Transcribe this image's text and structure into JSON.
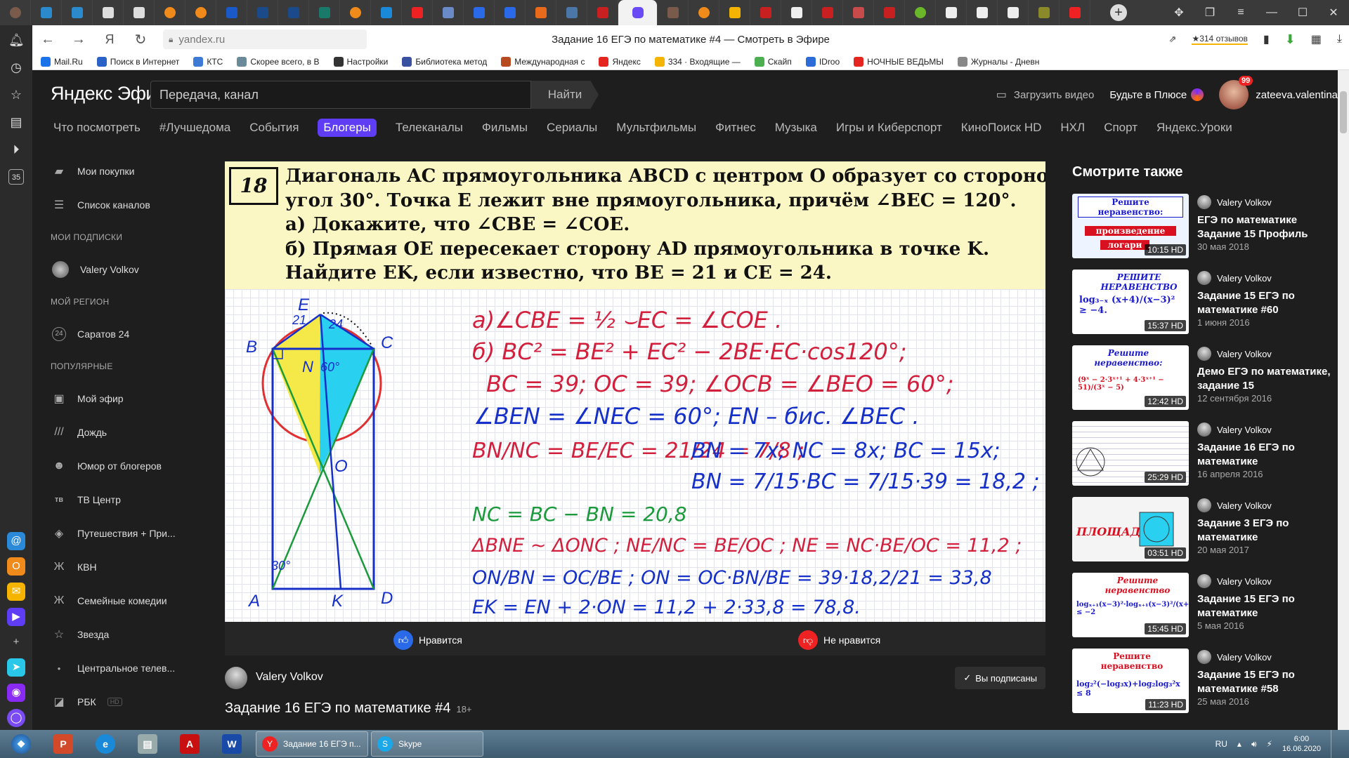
{
  "browser": {
    "tabs_count": 34,
    "address": "yandex.ru",
    "page_title": "Задание 16 ЕГЭ по математике #4 — Смотреть в Эфире",
    "reviews": "★314 отзывов"
  },
  "bookmarks": [
    {
      "label": "Mail.Ru",
      "color": "#1a73e8"
    },
    {
      "label": "Поиск в Интернет",
      "color": "#2a62c8"
    },
    {
      "label": "КТС",
      "color": "#3c7ad6"
    },
    {
      "label": "Скорее всего, в В",
      "color": "#6a8a9a"
    },
    {
      "label": "Настройки",
      "color": "#333333"
    },
    {
      "label": "Библиотека метод",
      "color": "#3a50a0"
    },
    {
      "label": "Международная с",
      "color": "#b84a20"
    },
    {
      "label": "Яндекс",
      "color": "#e52620"
    },
    {
      "label": "334 · Входящие —",
      "color": "#f5b400"
    },
    {
      "label": "Скайп",
      "color": "#4caf50"
    },
    {
      "label": "IDroo",
      "color": "#2b6cd6"
    },
    {
      "label": "НОЧНЫЕ ВЕДЬМЫ",
      "color": "#e52620"
    },
    {
      "label": "Журналы - Дневн",
      "color": "#888888"
    }
  ],
  "header": {
    "logo": "Яндекс Эфир",
    "search_placeholder": "Передача, канал",
    "search_button": "Найти",
    "upload": "Загрузить видео",
    "plus": "Будьте в Плюсе",
    "username": "zateeva.valentina",
    "notif_badge": "99"
  },
  "categories": [
    "Что посмотреть",
    "#Лучшедома",
    "События",
    "Блогеры",
    "Телеканалы",
    "Фильмы",
    "Сериалы",
    "Мультфильмы",
    "Фитнес",
    "Музыка",
    "Игры и Киберспорт",
    "КиноПоиск HD",
    "НХЛ",
    "Спорт",
    "Яндекс.Уроки"
  ],
  "active_category": "Блогеры",
  "sidebar": {
    "purchases": "Мои покупки",
    "channel_list": "Список каналов",
    "subs_header": "МОИ ПОДПИСКИ",
    "sub1": "Valery Volkov",
    "region_header": "МОЙ РЕГИОН",
    "region": "Саратов 24",
    "region_icon": "24",
    "popular_header": "ПОПУЛЯРНЫЕ",
    "popular": [
      {
        "label": "Мой эфир",
        "icon": "▣"
      },
      {
        "label": "Дождь",
        "icon": "///"
      },
      {
        "label": "Юмор от блогеров",
        "icon": "☻"
      },
      {
        "label": "ТВ Центр",
        "icon": "тв"
      },
      {
        "label": "Путешествия + При...",
        "icon": "◈"
      },
      {
        "label": "КВН",
        "icon": "Ж"
      },
      {
        "label": "Семейные комедии",
        "icon": "Ж"
      },
      {
        "label": "Звезда",
        "icon": "☆"
      },
      {
        "label": "Центральное телев...",
        "icon": "●"
      },
      {
        "label": "РБК",
        "icon": "◪",
        "tag": "HD"
      }
    ]
  },
  "video": {
    "problem": {
      "number": "18",
      "lines": [
        "Диагональ AC прямоугольника ABCD с центром O образует со стороной AB",
        "угол 30°. Точка E лежит вне прямоугольника, причём ∠BEC = 120°.",
        "а) Докажите, что ∠CBE = ∠COE.",
        "б) Прямая OE пересекает сторону AD прямоугольника в точке K.",
        "Найдите EK, если известно, что BE = 21 и CE = 24."
      ]
    },
    "figure": {
      "E": "E",
      "B": "B",
      "C": "C",
      "N": "N",
      "O": "O",
      "A": "A",
      "K": "K",
      "D": "D",
      "be": "21",
      "ce": "24",
      "angle_top": "60°",
      "angle_bottom": "30°"
    },
    "solution": [
      "а)∠CBE = ½ ⌣EC = ∠COE .",
      "б) BC² = BE² + EC² − 2BE·EC·cos120°;",
      "BC = 39; OC = 39; ∠OCB = ∠BEO = 60°;",
      "∠BEN = ∠NEC = 60°; EN – бис. ∠BEC .",
      "BN/NC = BE/EC = 21/24 = 7/8 ;",
      "BN = 7x; NC = 8x; BC = 15x;",
      "BN = 7/15·BC = 7/15·39 = 18,2 ;",
      "NC = BC − BN = 20,8",
      "ΔBNE ~ ΔONC ; NE/NC = BE/OC ; NE = NC·BE/OC = 11,2 ;",
      "ON/BN = OC/BE ; ON = OC·BN/BE = 39·18,2/21 = 33,8",
      "EK = EN + 2·ON = 11,2 + 2·33,8 = 78,8."
    ]
  },
  "likes": {
    "like": "Нравится",
    "dislike": "Не нравится"
  },
  "channel": {
    "name": "Valery Volkov",
    "subscribed": "Вы подписаны"
  },
  "video_title": "Задание 16 ЕГЭ по математике #4",
  "age": "18+",
  "related_header": "Смотрите также",
  "related": [
    {
      "channel": "Valery Volkov",
      "title": "ЕГЭ по математике Задание 15 Профиль",
      "date": "30 мая 2018",
      "duration": "10:15 HD",
      "thumb_text": "Решите неравенство:",
      "thumb_sub": "произведение",
      "thumb_sub2": "логари"
    },
    {
      "channel": "Valery Volkov",
      "title": "Задание 15 ЕГЭ по математике #60",
      "date": "1 июня 2016",
      "duration": "15:37 HD",
      "thumb_text": "РЕШИТЕ НЕРАВЕНСТВО",
      "thumb_sub": "log₃₋ₓ (x+4)/(x−3)² ≥ −4."
    },
    {
      "channel": "Valery Volkov",
      "title": "Демо ЕГЭ по математике, задание 15",
      "date": "12 сентября 2016",
      "duration": "12:42 HD",
      "thumb_text": "Решите неравенство:",
      "thumb_sub": "(9ˣ − 2·3ˣ⁺¹ + 4·3ˣ⁺¹ − 51)/(3ˣ − 5)"
    },
    {
      "channel": "Valery Volkov",
      "title": "Задание 16 ЕГЭ по математике",
      "date": "16 апреля 2016",
      "duration": "25:29 HD",
      "thumb_text": "",
      "thumb_sub": ""
    },
    {
      "channel": "Valery Volkov",
      "title": "Задание 3 ЕГЭ по математике",
      "date": "20 мая 2017",
      "duration": "03:51 HD",
      "thumb_text": "ПЛОЩАДЬ?",
      "thumb_sub": ""
    },
    {
      "channel": "Valery Volkov",
      "title": "Задание 15 ЕГЭ по математике",
      "date": "5 мая 2016",
      "duration": "15:45 HD",
      "thumb_text": "Решите неравенство",
      "thumb_sub": "logₓ₊₁(x−3)²·logₓ₊₁(x−3)²/(x+1) ≤ −2"
    },
    {
      "channel": "Valery Volkov",
      "title": "Задание 15 ЕГЭ по математике #58",
      "date": "25 мая 2016",
      "duration": "11:23 HD",
      "thumb_text": "Решите неравенство",
      "thumb_sub": "log₂²(−log₃x)+log₂log₃²x ≤ 8"
    }
  ],
  "taskbar": {
    "window1": "Задание 16 ЕГЭ п...",
    "window2": "Skype",
    "lang": "RU",
    "time": "6:00",
    "date": "16.06.2020"
  },
  "colors": {
    "accent": "#5e3df5",
    "problem_bg": "#fbf7c4",
    "ink_red": "#d21f3c",
    "ink_blue": "#1530c8",
    "fig_yellow": "#f5e94a",
    "fig_cyan": "#2ad0f0"
  }
}
